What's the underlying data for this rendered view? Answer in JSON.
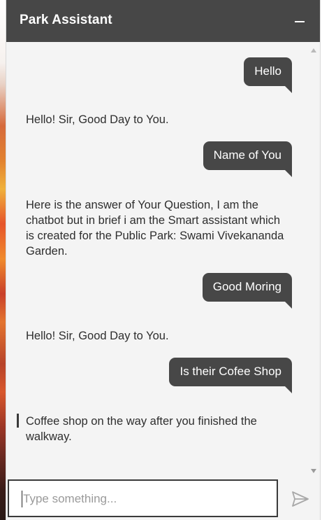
{
  "header": {
    "title": "Park Assistant"
  },
  "conversation": {
    "messages": [
      {
        "role": "user",
        "text": "Hello"
      },
      {
        "role": "bot",
        "text": "Hello! Sir, Good Day to You."
      },
      {
        "role": "user",
        "text": "Name of You"
      },
      {
        "role": "bot",
        "text": "Here is the answer of Your Question, I am the chatbot but in brief i am the Smart assistant which is created for the Public Park: Swami Vivekananda Garden."
      },
      {
        "role": "user",
        "text": "Good Moring"
      },
      {
        "role": "bot",
        "text": "Hello! Sir, Good Day to You."
      },
      {
        "role": "user",
        "text": "Is their Cofee Shop"
      },
      {
        "role": "bot",
        "text": "Coffee shop on the way after you finished the walkway."
      }
    ]
  },
  "composer": {
    "placeholder": "Type something...",
    "value": ""
  },
  "colors": {
    "header_bg": "#474747",
    "user_bubble": "#474747",
    "panel_bg": "#f4f4f4"
  },
  "icons": {
    "minimize": "minimize-icon",
    "send": "send-icon"
  }
}
